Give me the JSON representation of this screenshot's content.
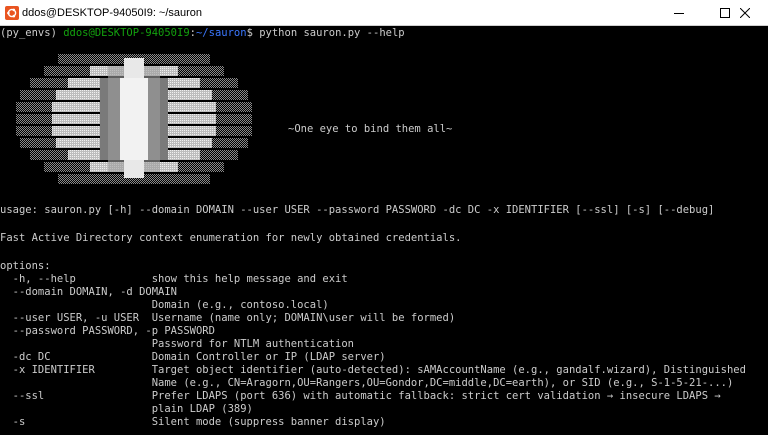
{
  "window": {
    "title": "ddos@DESKTOP-94050I9: ~/sauron",
    "min_glyph": "minimize-icon",
    "max_glyph": "maximize-icon",
    "close_glyph": "close-icon"
  },
  "colors": {
    "user": "#13a10e",
    "path": "#3b78ff",
    "text": "#cccccc",
    "bg": "#000000",
    "banner_light": "#e6e6e6",
    "banner_mid": "#9a9a9a",
    "banner_dark": "#5a5a5a"
  },
  "prompt": {
    "env": "(py_envs) ",
    "user": "ddos@DESKTOP-94050I9",
    "sep": ":",
    "path": "~/sauron",
    "dollar": "$ ",
    "command": "python sauron.py --help"
  },
  "banner": {
    "tagline": "~One eye to bind them all~"
  },
  "usage": "usage: sauron.py [-h] --domain DOMAIN --user USER --password PASSWORD -dc DC -x IDENTIFIER [--ssl] [-s] [--debug]",
  "description": "Fast Active Directory context enumeration for newly obtained credentials.",
  "options_header": "options:",
  "options": [
    {
      "text": "  -h, --help            show this help message and exit"
    },
    {
      "text": "  --domain DOMAIN, -d DOMAIN"
    },
    {
      "text": "                        Domain (e.g., contoso.local)"
    },
    {
      "text": "  --user USER, -u USER  Username (name only; DOMAIN\\user will be formed)"
    },
    {
      "text": "  --password PASSWORD, -p PASSWORD"
    },
    {
      "text": "                        Password for NTLM authentication"
    },
    {
      "text": "  -dc DC                Domain Controller or IP (LDAP server)"
    },
    {
      "text": "  -x IDENTIFIER         Target object identifier (auto-detected): sAMAccountName (e.g., gandalf.wizard), Distinguished"
    },
    {
      "text": "                        Name (e.g., CN=Aragorn,OU=Rangers,OU=Gondor,DC=middle,DC=earth), or SID (e.g., S-1-5-21-...)"
    },
    {
      "text": "  --ssl                 Prefer LDAPS (port 636) with automatic fallback: strict cert validation → insecure LDAPS →"
    },
    {
      "text": "                        plain LDAP (389)"
    },
    {
      "text": "  -s                    Silent mode (suppress banner display)"
    }
  ]
}
